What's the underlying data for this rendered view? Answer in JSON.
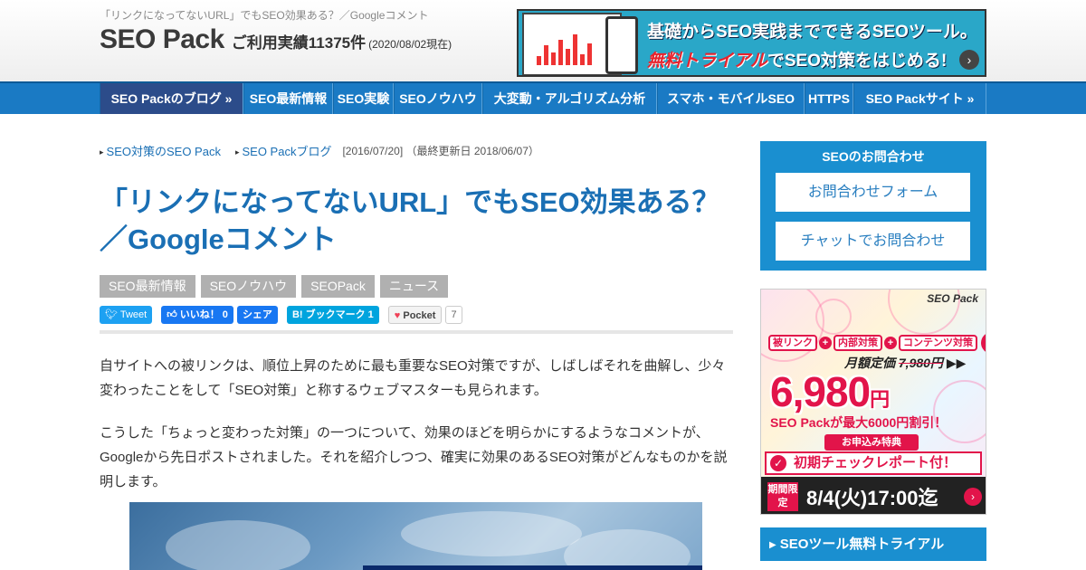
{
  "header": {
    "tagline": "「リンクになってないURL」でもSEO効果ある？／Googleコメント",
    "logo": "SEO Pack",
    "usage": "ご利用実績11375件",
    "usage_date": "(2020/08/02現在)",
    "banner": {
      "line1": "基礎からSEO実践までできるSEOツール。",
      "line2_red": "無料トライアル",
      "line2_rest": "でSEO対策をはじめる!",
      "arrow": "›"
    }
  },
  "nav": {
    "items": [
      {
        "label": "SEO Packのブログ »"
      },
      {
        "label": "SEO最新情報"
      },
      {
        "label": "SEO実験"
      },
      {
        "label": "SEOノウハウ"
      },
      {
        "label": "大変動・アルゴリズム分析"
      },
      {
        "label": "スマホ・モバイルSEO"
      },
      {
        "label": "HTTPS"
      },
      {
        "label": "SEO Packサイト »"
      }
    ]
  },
  "breadcrumb": {
    "items": [
      "SEO対策のSEO Pack",
      "SEO Packブログ"
    ],
    "date": "[2016/07/20] （最終更新日 2018/06/07）"
  },
  "article": {
    "title": "「リンクになってないURL」でもSEO効果ある？／Googleコメント",
    "tags": [
      "SEO最新情報",
      "SEOノウハウ",
      "SEOPack",
      "ニュース"
    ],
    "paragraphs": [
      "自サイトへの被リンクは、順位上昇のために最も重要なSEO対策ですが、しばしばそれを曲解し、少々変わったことをして「SEO対策」と称するウェブマスターも見られます。",
      "こうした「ちょっと変わった対策」の一つについて、効果のほどを明らかにするようなコメントが、Googleから先日ポストされました。それを紹介しつつ、確実に効果のあるSEO対策がどんなものかを説明します。"
    ]
  },
  "share": {
    "tweet": "Tweet",
    "like": "いいね！ 0",
    "fb_share": "シェア",
    "hatena": "B! ブックマーク  1",
    "pocket": "Pocket",
    "pocket_count": "7"
  },
  "sidebar": {
    "contact": {
      "title": "SEOのお問合わせ",
      "form": "お問合わせフォーム",
      "chat": "チャットでお問合わせ"
    },
    "ad": {
      "logo": "SEO Pack",
      "pill1": "被リンク",
      "pill2": "内部対策",
      "pill3": "コンテンツ対策",
      "badge": "ｶﾞ",
      "old_label": "月額定価",
      "old_price": "7,980円",
      "price": "6,980",
      "yen": "円",
      "discount": "SEO Packが最大6000円割引！",
      "special": "お申込み特典",
      "report": "初期チェックレポート付！",
      "limit": "期間限定",
      "date": "8/4(火)17:00迄"
    },
    "trial": "SEOツール無料トライアル"
  },
  "colors": {
    "nav": "#1a7ac4",
    "nav_active": "#2c4c8a",
    "link": "#1a6fb4",
    "sidebar_blue": "#1a8fd0",
    "ad_red": "#e2144a"
  }
}
